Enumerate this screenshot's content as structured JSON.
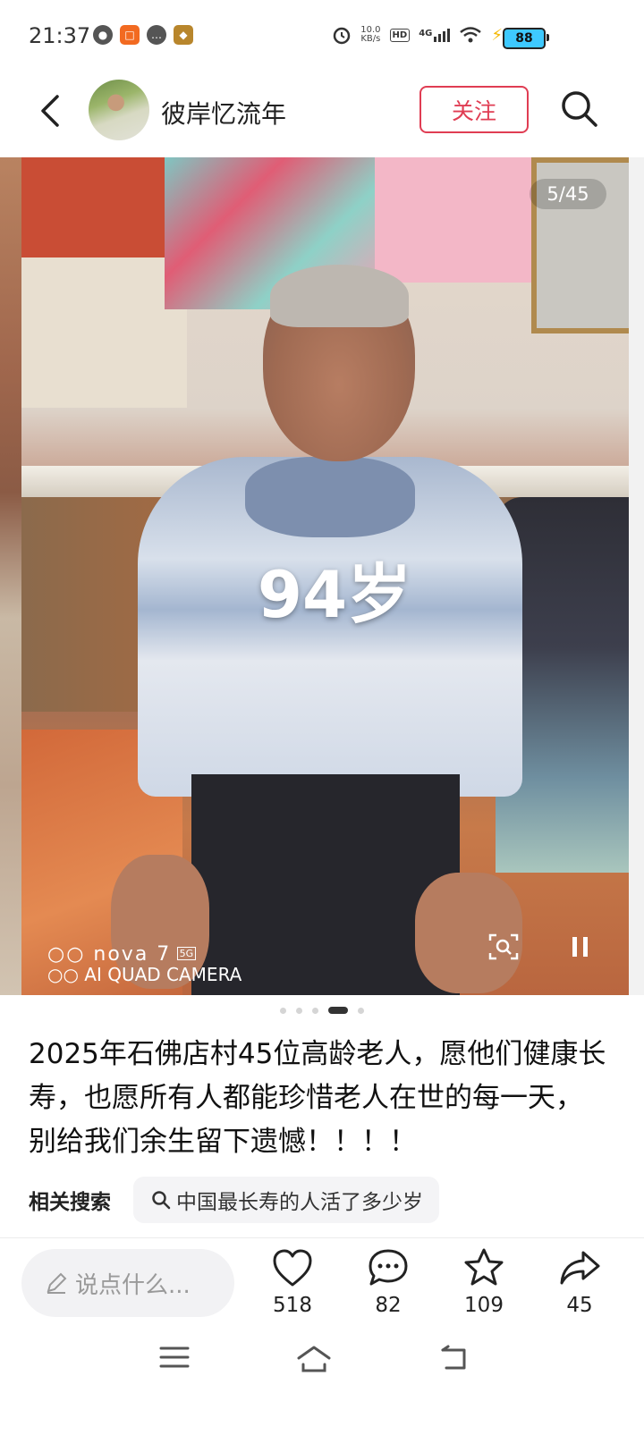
{
  "status_bar": {
    "time": "21:37",
    "net_speed_value": "10.0",
    "net_speed_unit": "KB/s",
    "hd_label": "HD",
    "network": "4G",
    "battery": "88",
    "left_icons": [
      "wechat-icon",
      "app-icon",
      "message-icon",
      "game-icon"
    ]
  },
  "header": {
    "author_name": "彼岸忆流年",
    "follow_label": "关注"
  },
  "media": {
    "overlay_text": "94岁",
    "page_counter": "5/45",
    "watermark_brand": "nova 7",
    "watermark_5g": "5G",
    "watermark_sub": "AI QUAD CAMERA",
    "current_page": 5,
    "total_pages": 45
  },
  "post": {
    "caption": "2025年石佛店村45位高龄老人，愿他们健康长寿，也愿所有人都能珍惜老人在世的每一天，别给我们余生留下遗憾！！！！",
    "related_label": "相关搜索",
    "related_query": "中国最长寿的人活了多少岁"
  },
  "bottom_bar": {
    "comment_placeholder": "说点什么...",
    "likes": "518",
    "comments": "82",
    "favorites": "109",
    "shares": "45"
  },
  "colors": {
    "accent": "#e03d53",
    "battery": "#3ec9ff"
  }
}
